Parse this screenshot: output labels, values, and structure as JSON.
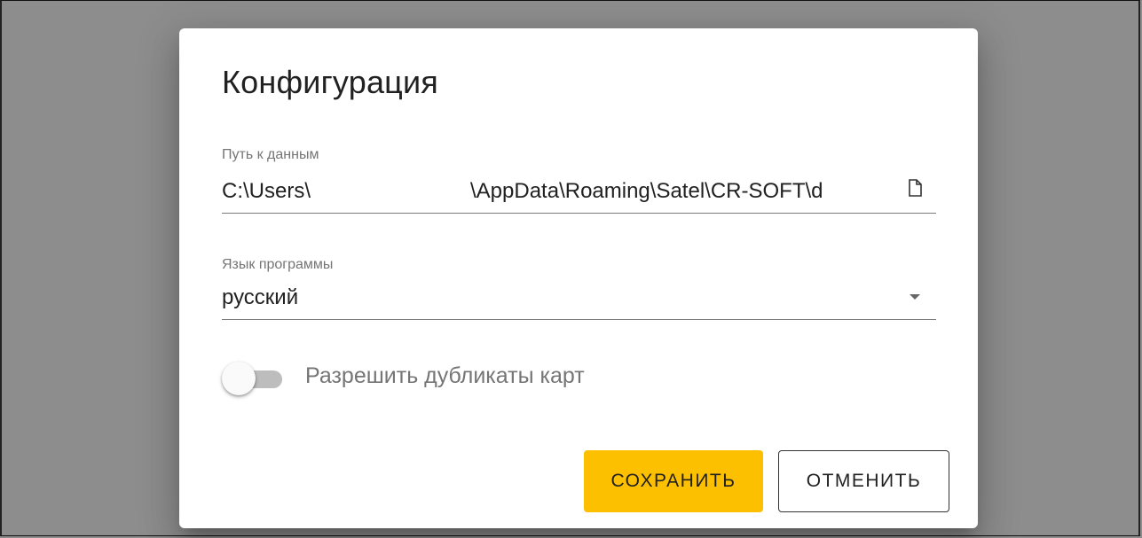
{
  "dialog": {
    "title": "Конфигурация",
    "data_path": {
      "label": "Путь к данным",
      "value_start": "C:\\Users\\",
      "value_end": "\\AppData\\Roaming\\Satel\\CR-SOFT\\d"
    },
    "language": {
      "label": "Язык программы",
      "selected": "русский"
    },
    "toggle": {
      "label": "Разрешить дубликаты карт",
      "checked": false
    },
    "buttons": {
      "save": "СОХРАНИТЬ",
      "cancel": "ОТМЕНИТЬ"
    },
    "colors": {
      "accent": "#fcc000",
      "backdrop": "#8d8d8d"
    },
    "icons": {
      "file": "file-icon",
      "dropdown": "dropdown-arrow-icon"
    }
  }
}
